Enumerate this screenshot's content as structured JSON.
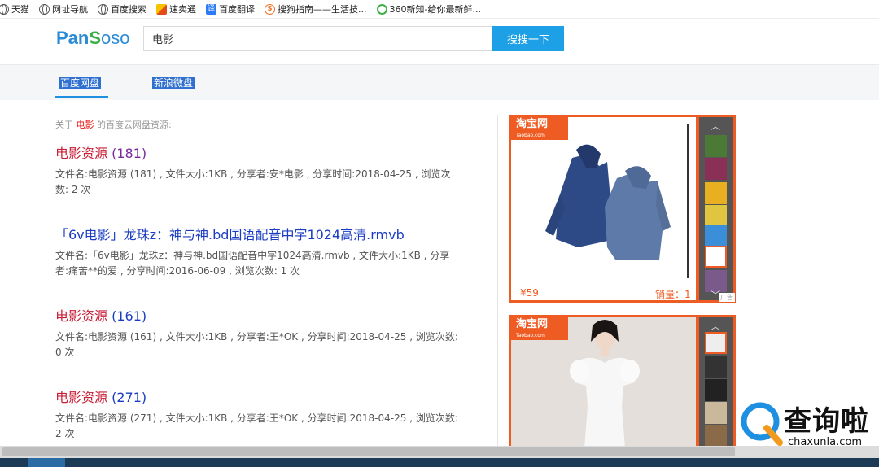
{
  "bookmarks": [
    {
      "label": "天猫",
      "icon": "globe-icon"
    },
    {
      "label": "网址导航",
      "icon": "globe-icon"
    },
    {
      "label": "百度搜索",
      "icon": "globe-icon"
    },
    {
      "label": "速卖通",
      "icon": "sumaitong-icon"
    },
    {
      "label": "百度翻译",
      "icon": "baidu-translate-icon"
    },
    {
      "label": "搜狗指南——生活技...",
      "icon": "sougou-icon"
    },
    {
      "label": "360新知-给你最新鲜...",
      "icon": "360-icon"
    }
  ],
  "header": {
    "logo": {
      "p1": "Pan",
      "p2": "S",
      "p3": "oso"
    },
    "search_value": "电影",
    "search_button": "搜搜一下"
  },
  "tabs": [
    {
      "label": "百度网盘",
      "active": true
    },
    {
      "label": "新浪微盘",
      "active": false
    }
  ],
  "results": {
    "about_prefix": "关于",
    "about_keyword": "电影",
    "about_suffix": "的百度云网盘资源:",
    "items": [
      {
        "title_main": "电影资源",
        "title_count": "(181)",
        "desc": "文件名:电影资源 (181) , 文件大小:1KB , 分享者:安*电影 , 分享时间:2018-04-25 , 浏览次数: 2 次"
      },
      {
        "title_main": "「6v电影」龙珠z：神与神.bd国语配音中字1024高清.rmvb",
        "title_count": "",
        "desc": "文件名:「6v电影」龙珠z：神与神.bd国语配音中字1024高清.rmvb , 文件大小:1KB , 分享者:痛苦**的爱 , 分享时间:2016-06-09 , 浏览次数: 1 次"
      },
      {
        "title_main": "电影资源",
        "title_count": "(161)",
        "desc": "文件名:电影资源 (161) , 文件大小:1KB , 分享者:王*OK , 分享时间:2018-04-25 , 浏览次数: 0 次"
      },
      {
        "title_main": "电影资源",
        "title_count": "(271)",
        "desc": "文件名:电影资源 (271) , 文件大小:1KB , 分享者:王*OK , 分享时间:2018-04-25 , 浏览次数: 2 次"
      }
    ]
  },
  "ads": [
    {
      "badge": "淘宝网",
      "badge_sub": "Taobao.com",
      "price": "¥59",
      "sales": "销量：1",
      "tag": "广告"
    },
    {
      "badge": "淘宝网",
      "badge_sub": "Taobao.com"
    }
  ],
  "watermark": {
    "text": "查询啦",
    "url": "chaxunla.com"
  },
  "colors": {
    "accent": "#1ea0e6",
    "title_red": "#c91f37",
    "link_blue": "#1a3cc2",
    "taobao_orange": "#ee5c23"
  }
}
